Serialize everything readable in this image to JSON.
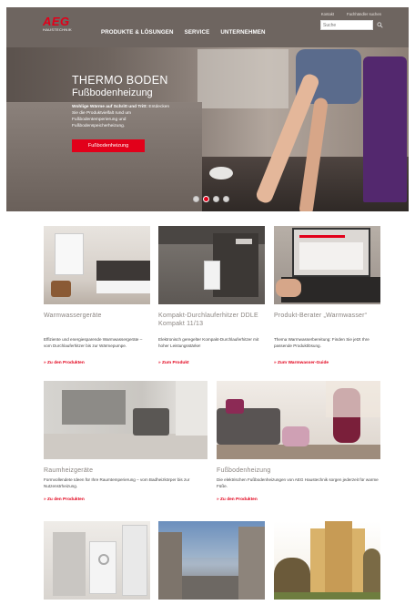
{
  "header": {
    "logo_main": "AEG",
    "logo_sub": "HAUSTECHNIK",
    "nav": [
      "PRODUKTE & LÖSUNGEN",
      "SERVICE",
      "UNTERNEHMEN"
    ],
    "utility": [
      "Kontakt",
      "Fachhändler suchen"
    ],
    "search_placeholder": "Suche"
  },
  "hero": {
    "title": "THERMO BODEN",
    "subtitle": "Fußbodenheizung",
    "text_strong": "Wohlige Wärme auf Schritt und Tritt:",
    "text": "Entdecken Sie die Produktvielfalt rund um Fußbodentemperierung und Fußbodenspeicherheizung.",
    "button": "Fußbodenheizung",
    "slide_count": 4,
    "active_slide": 2
  },
  "tiles_row1": [
    {
      "title": "Warmwassergeräte",
      "desc": "Effiziente und energiesparende Warmwassergeräte – vom Durchlauferhitzer bis zur Wärmepumpe.",
      "link": "» Zu den Produkten"
    },
    {
      "title": "Kompakt-Durchlauferhitzer DDLE Kompakt 11/13",
      "desc": "Elektronisch geregelter Kompakt-Durchlauferhitzer mit hoher Leistungsstärke!",
      "link": "» Zum Produkt"
    },
    {
      "title": "Produkt-Berater „Warmwasser“",
      "desc": "Thema Warmwasserbereitung: Finden Sie jetzt Ihre passende Produktlösung.",
      "link": "» Zum Warmwasser-Guide"
    }
  ],
  "tiles_row2": [
    {
      "title": "Raumheizgeräte",
      "desc": "Formvollendete Ideen für Ihre Raumtemperierung – vom Badheizkörper bis zur Nutzenstrheizung.",
      "link": "» Zu den Produkten"
    },
    {
      "title": "Fußbodenheizung",
      "desc": "Die elektrischen Fußbodenheizungen von AEG Haustechnik sorgen jederzeit für warme Füße.",
      "link": "» Zu den Produkten"
    }
  ]
}
